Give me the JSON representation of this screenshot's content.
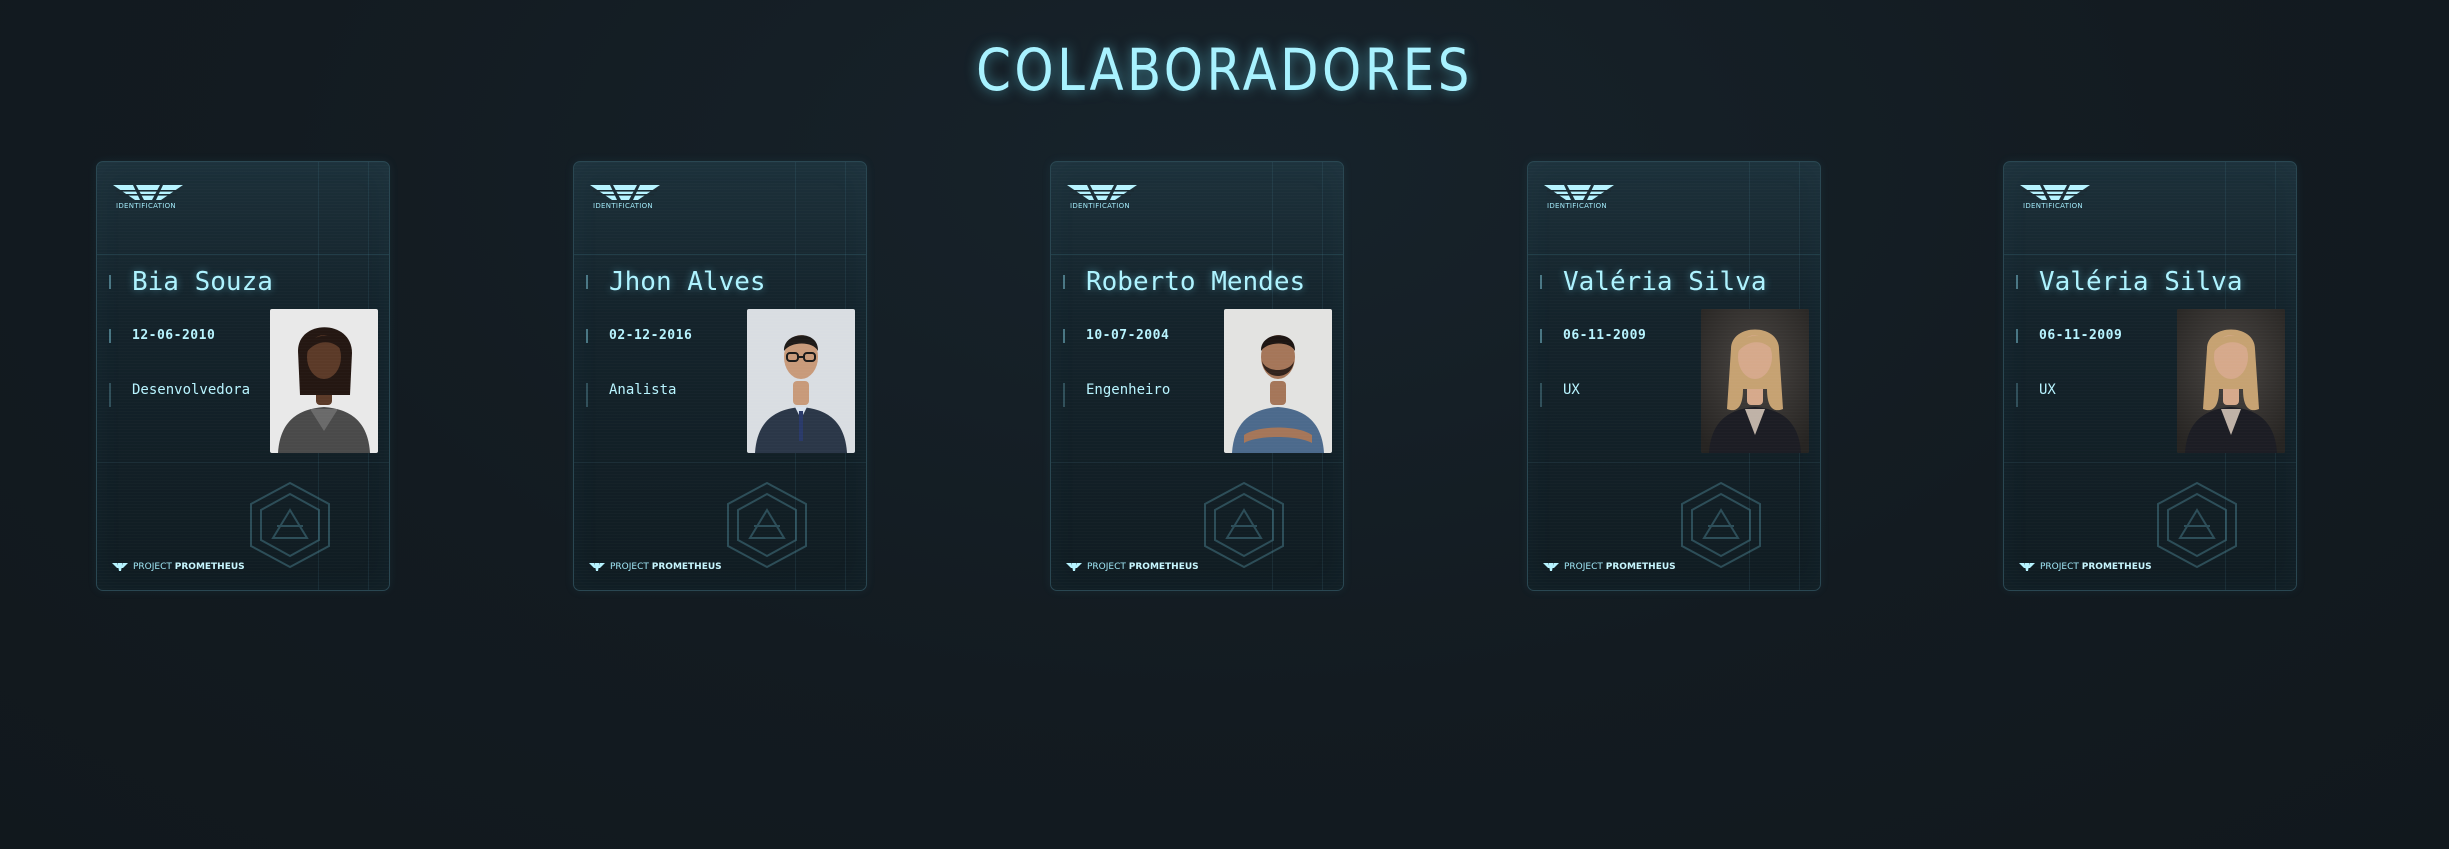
{
  "page": {
    "title": "COLABORADORES"
  },
  "card_common": {
    "logo_caption": "IDENTIFICATION",
    "footer_prefix": "PROJECT",
    "footer_brand": "PROMETHEUS",
    "logo_icon": "weyland-wings-icon",
    "emblem_icon": "hexagon-emblem-icon"
  },
  "colors": {
    "accent": "#a8f2ff",
    "background": "#141c22",
    "card_border": "#2a4752"
  },
  "cards": [
    {
      "name": "Bia Souza",
      "date": "12-06-2010",
      "role": "Desenvolvedora",
      "photo": "woman-portrait-white-background",
      "photo_bg": "#e9e9e9",
      "skin": "#5b3a28",
      "hair": "#241712",
      "shirt": "#4a4a4a"
    },
    {
      "name": "Jhon Alves",
      "date": "02-12-2016",
      "role": "Analista",
      "photo": "man-suit-glasses-portrait",
      "photo_bg": "#d9dde2",
      "skin": "#c89a7a",
      "hair": "#1e1a18",
      "shirt": "#2b3748"
    },
    {
      "name": "Roberto Mendes",
      "date": "10-07-2004",
      "role": "Engenheiro",
      "photo": "man-blue-tshirt-portrait",
      "photo_bg": "#e3e3e1",
      "skin": "#a57659",
      "hair": "#1d1512",
      "shirt": "#4c6a8c"
    },
    {
      "name": "Valéria Silva",
      "date": "06-11-2009",
      "role": "UX",
      "photo": "woman-blonde-suit-portrait",
      "photo_bg": "#3a3735",
      "skin": "#d6a98b",
      "hair": "#c6a272",
      "shirt": "#1c1d24"
    },
    {
      "name": "Valéria Silva",
      "date": "06-11-2009",
      "role": "UX",
      "photo": "woman-blonde-suit-portrait",
      "photo_bg": "#3a3735",
      "skin": "#d6a98b",
      "hair": "#c6a272",
      "shirt": "#1c1d24"
    }
  ]
}
